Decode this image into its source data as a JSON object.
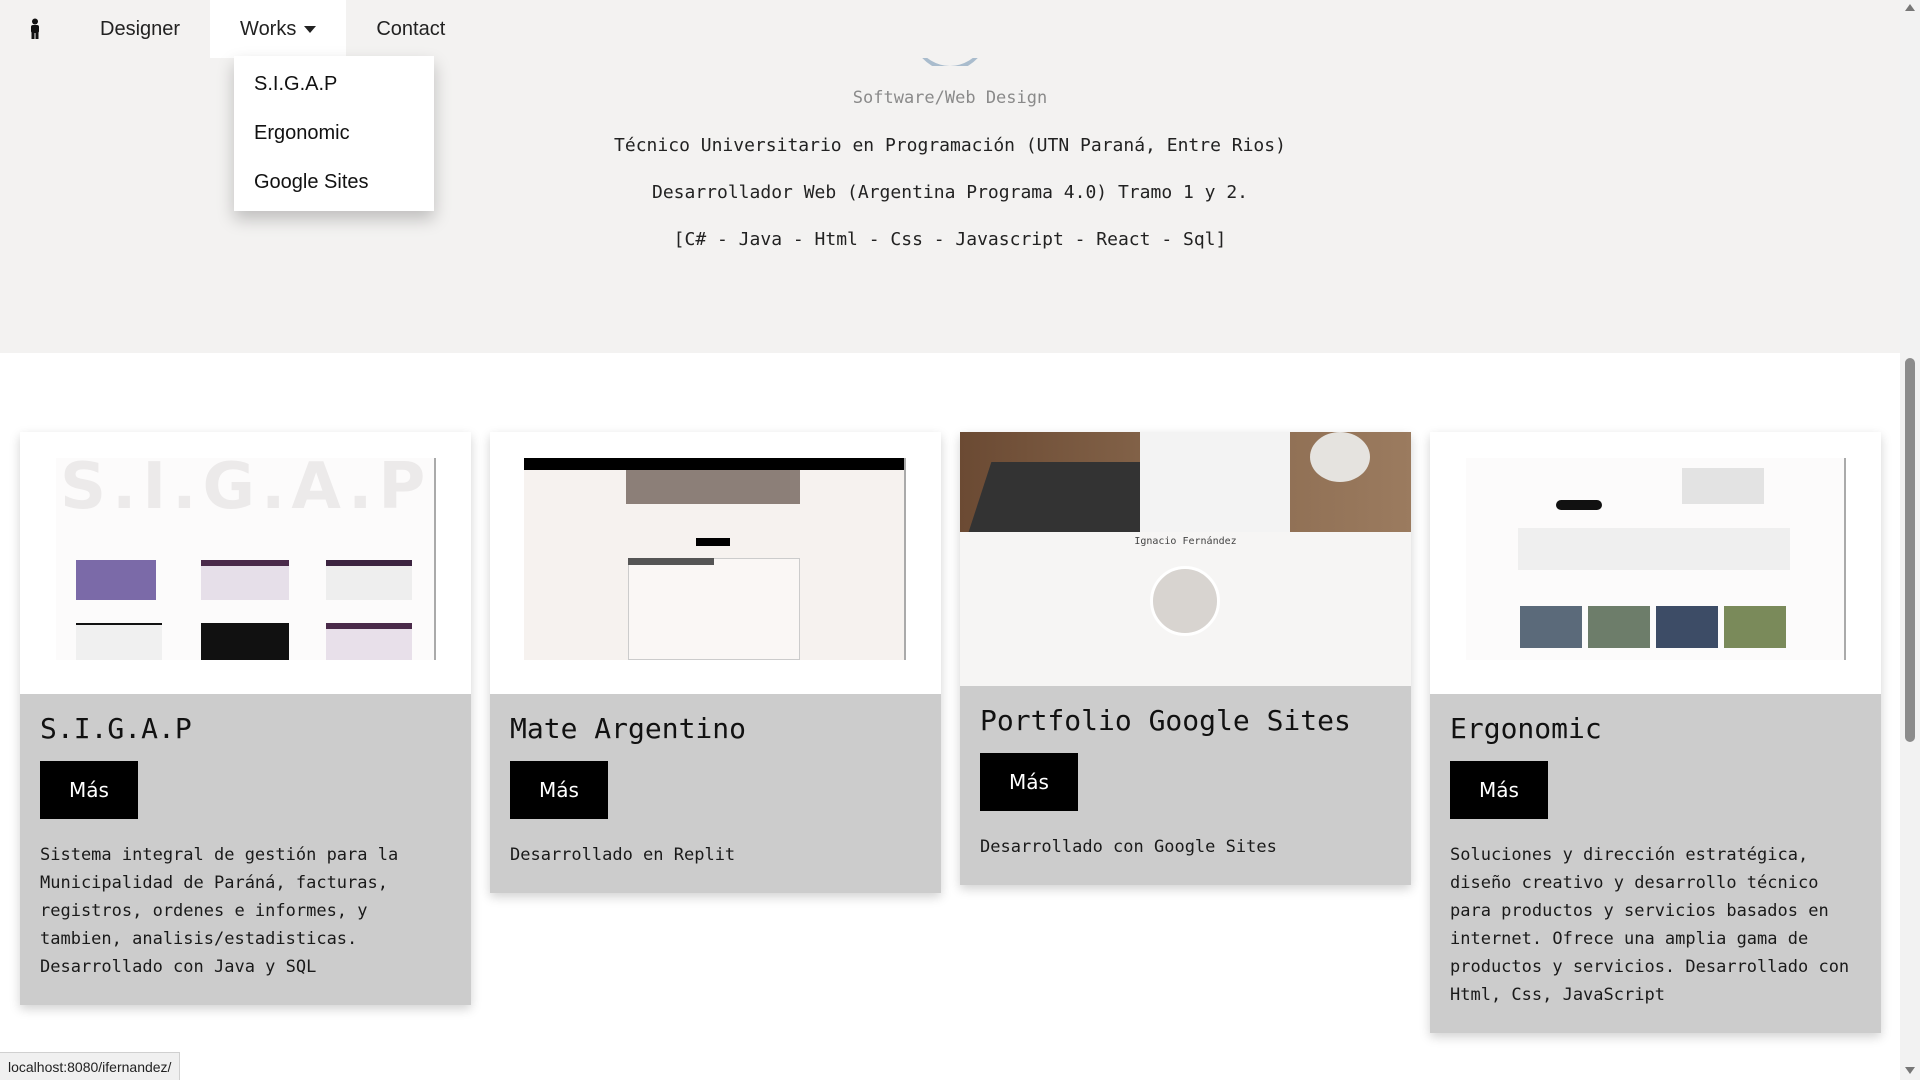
{
  "nav": {
    "items": [
      {
        "label": "Designer"
      },
      {
        "label": "Works"
      },
      {
        "label": "Contact"
      }
    ],
    "dropdown": [
      "S.I.G.A.P",
      "Ergonomic",
      "Google Sites"
    ]
  },
  "hero": {
    "subtitle": "Software/Web Design",
    "lines": [
      "Técnico Universitario en Programación (UTN Paraná, Entre Rios)",
      "Desarrollador Web (Argentina Programa 4.0) Tramo 1 y 2.",
      "[C# - Java - Html - Css - Javascript - React - Sql]"
    ]
  },
  "cards": [
    {
      "title": "S.I.G.A.P",
      "button": "Más",
      "description": "Sistema integral de gestión para la Municipalidad de Paráná, facturas, registros, ordenes e informes, y tambien, analisis/estadisticas. Desarrollado con Java y SQL",
      "thumb_text": "S.I.G.A.P"
    },
    {
      "title": "Mate Argentino",
      "button": "Más",
      "description": "Desarrollado en Replit"
    },
    {
      "title": "Portfolio Google Sites",
      "button": "Más",
      "description": "Desarrollado con Google Sites",
      "thumb_name": "Ignacio Fernández"
    },
    {
      "title": "Ergonomic",
      "button": "Más",
      "description": "Soluciones y dirección estratégica, diseño creativo y desarrollo técnico para productos y servicios basados en internet. Ofrece una amplia gama de productos y servicios. Desarrollado con Html, Css, JavaScript"
    }
  ],
  "status_bar": {
    "url": "localhost:8080/ifernandez/"
  },
  "colors": {
    "hero_bg": "#f3f2f1",
    "card_bg": "#cccccc",
    "button_bg": "#000000"
  }
}
